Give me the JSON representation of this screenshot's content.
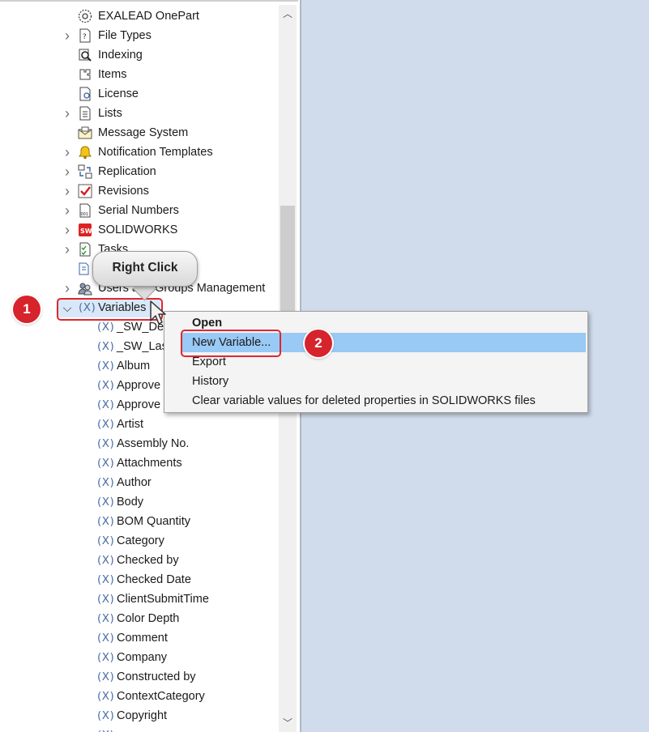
{
  "tree": {
    "items": [
      {
        "label": "EXALEAD OnePart",
        "icon": "exalead-icon",
        "expand": "none"
      },
      {
        "label": "File Types",
        "icon": "file-types-icon",
        "expand": "collapsed"
      },
      {
        "label": "Indexing",
        "icon": "indexing-icon",
        "expand": "none"
      },
      {
        "label": "Items",
        "icon": "items-icon",
        "expand": "none"
      },
      {
        "label": "License",
        "icon": "license-icon",
        "expand": "none"
      },
      {
        "label": "Lists",
        "icon": "lists-icon",
        "expand": "collapsed"
      },
      {
        "label": "Message System",
        "icon": "message-system-icon",
        "expand": "none"
      },
      {
        "label": "Notification Templates",
        "icon": "bell-icon",
        "expand": "collapsed"
      },
      {
        "label": "Replication",
        "icon": "replication-icon",
        "expand": "collapsed"
      },
      {
        "label": "Revisions",
        "icon": "revisions-icon",
        "expand": "collapsed"
      },
      {
        "label": "Serial Numbers",
        "icon": "serial-numbers-icon",
        "expand": "collapsed"
      },
      {
        "label": "SOLIDWORKS",
        "icon": "solidworks-icon",
        "expand": "collapsed"
      },
      {
        "label": "Tasks",
        "icon": "tasks-icon",
        "expand": "collapsed"
      },
      {
        "label": "",
        "icon": "templates-icon",
        "expand": "none"
      },
      {
        "label": "Users and Groups Management",
        "icon": "users-icon",
        "expand": "collapsed"
      },
      {
        "label": "Variables",
        "icon": "variable-icon",
        "expand": "expanded"
      }
    ],
    "variable_icon_text": "(X)",
    "variables": [
      "_SW_De",
      "_SW_Last",
      "Album",
      "Approve",
      "Approve",
      "Artist",
      "Assembly No.",
      "Attachments",
      "Author",
      "Body",
      "BOM Quantity",
      "Category",
      "Checked by",
      "Checked Date",
      "ClientSubmitTime",
      "Color Depth",
      "Comment",
      "Company",
      "Constructed by",
      "ContextCategory",
      "Copyright",
      ""
    ]
  },
  "context_menu": {
    "items": [
      {
        "label": "Open",
        "bold": true
      },
      {
        "label": "New Variable...",
        "highlighted": true
      },
      {
        "label": "Export"
      },
      {
        "label": "History"
      },
      {
        "label": "Clear variable values for deleted properties in SOLIDWORKS files"
      }
    ]
  },
  "callouts": {
    "right_click": "Right Click",
    "step1": "1",
    "step2": "2"
  },
  "colors": {
    "accent_red": "#d6232c",
    "menu_highlight": "#99c9f5",
    "right_pane": "#d0dcec"
  }
}
